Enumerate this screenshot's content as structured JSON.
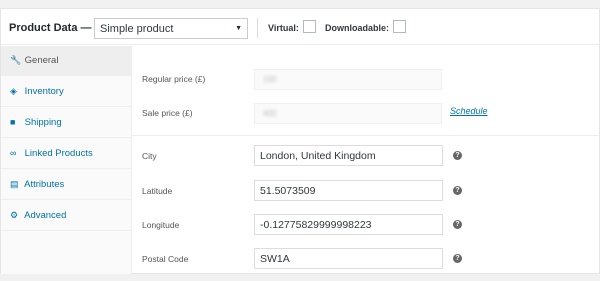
{
  "header": {
    "title": "Product Data —",
    "product_type": "Simple product",
    "virtual_label": "Virtual:",
    "downloadable_label": "Downloadable:"
  },
  "sidebar": {
    "items": [
      {
        "label": "General",
        "icon": "wrench-icon"
      },
      {
        "label": "Inventory",
        "icon": "tag-icon"
      },
      {
        "label": "Shipping",
        "icon": "truck-icon"
      },
      {
        "label": "Linked Products",
        "icon": "link-icon"
      },
      {
        "label": "Attributes",
        "icon": "list-icon"
      },
      {
        "label": "Advanced",
        "icon": "gear-icon"
      }
    ]
  },
  "pricing": {
    "regular_label": "Regular price (£)",
    "regular_value": "100",
    "sale_label": "Sale price (£)",
    "sale_value": "400",
    "schedule_link": "Schedule"
  },
  "location": {
    "city_label": "City",
    "city_value": "London, United Kingdom",
    "latitude_label": "Latitude",
    "latitude_value": "51.5073509",
    "longitude_label": "Longitude",
    "longitude_value": "-0.12775829999998223",
    "postal_label": "Postal Code",
    "postal_value": "SW1A"
  },
  "colors": {
    "link": "#0073aa",
    "active_tab_bg": "#eeeeee"
  }
}
